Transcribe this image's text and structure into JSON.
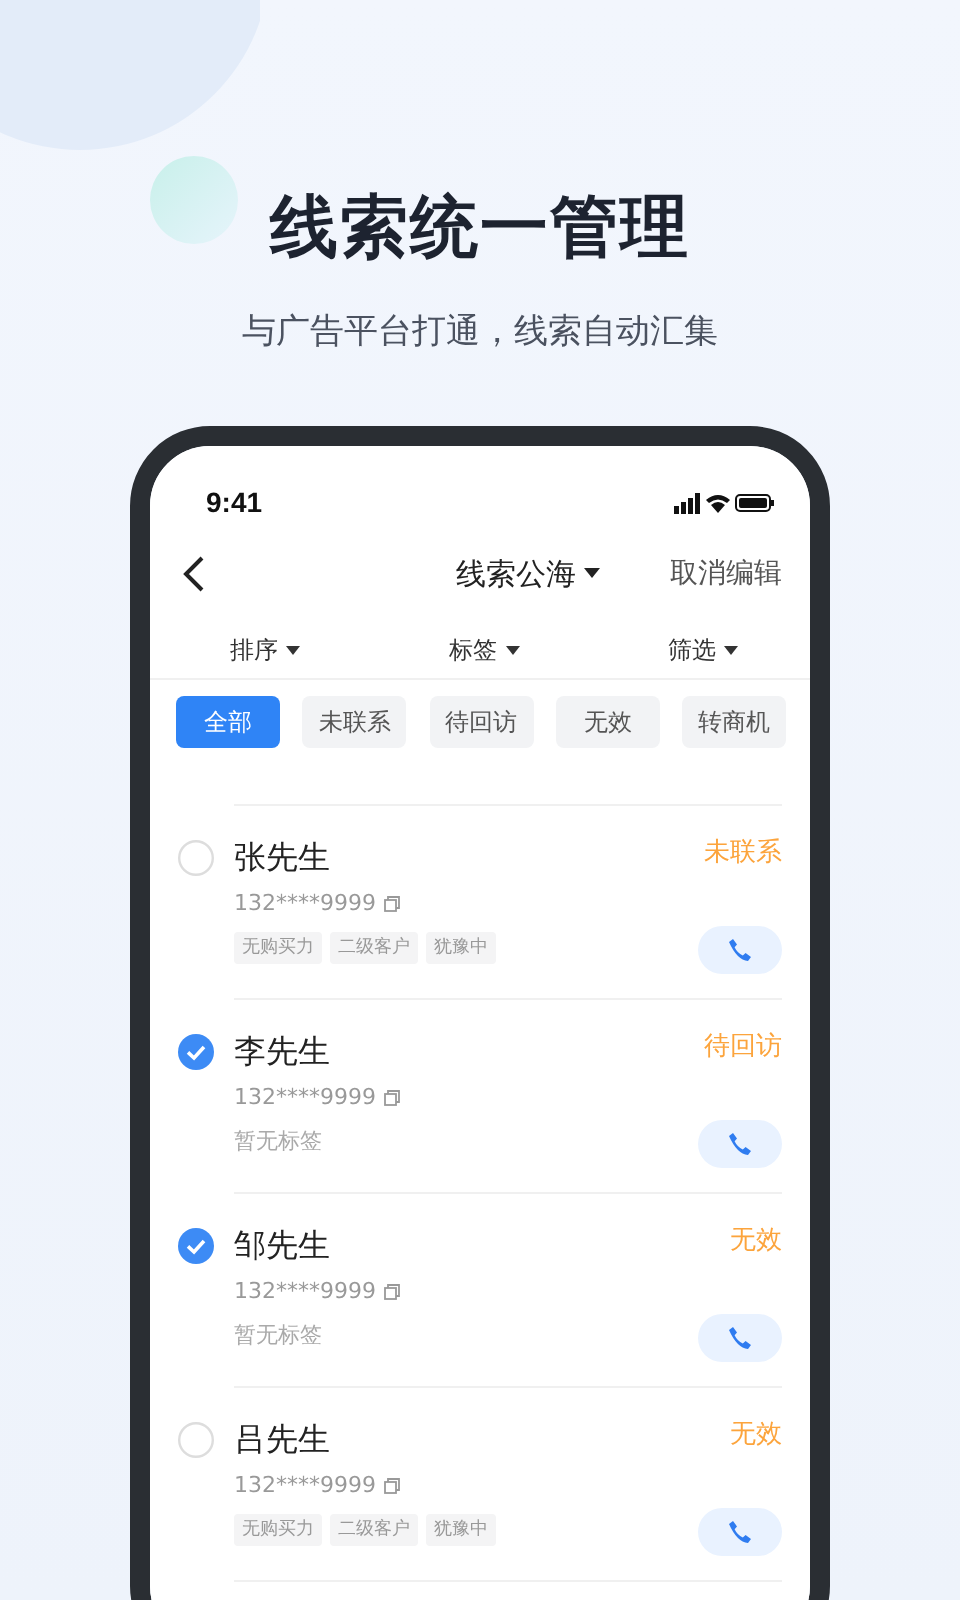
{
  "headline": "线索统一管理",
  "subtitle": "与广告平台打通，线索自动汇集",
  "status_bar": {
    "time": "9:41"
  },
  "nav": {
    "title": "线索公海",
    "action": "取消编辑"
  },
  "filters": [
    {
      "label": "排序"
    },
    {
      "label": "标签"
    },
    {
      "label": "筛选"
    }
  ],
  "chips": [
    {
      "label": "全部",
      "selected": true
    },
    {
      "label": "未联系",
      "selected": false
    },
    {
      "label": "待回访",
      "selected": false
    },
    {
      "label": "无效",
      "selected": false
    },
    {
      "label": "转商机",
      "selected": false
    }
  ],
  "leads": [
    {
      "name": "张先生",
      "checked": false,
      "status": "未联系",
      "phone": "132****9999",
      "tags": [
        "无购买力",
        "二级客户",
        "犹豫中"
      ]
    },
    {
      "name": "李先生",
      "checked": true,
      "status": "待回访",
      "phone": "132****9999",
      "note": "暂无标签"
    },
    {
      "name": "邹先生",
      "checked": true,
      "status": "无效",
      "phone": "132****9999",
      "note": "暂无标签"
    },
    {
      "name": "吕先生",
      "checked": false,
      "status": "无效",
      "phone": "132****9999",
      "tags": [
        "无购买力",
        "二级客户",
        "犹豫中"
      ]
    }
  ]
}
